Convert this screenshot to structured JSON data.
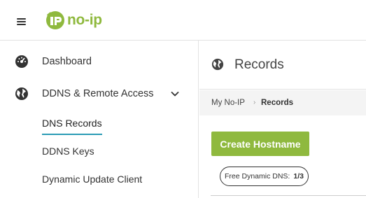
{
  "header": {
    "menu_icon": "hamburger-icon",
    "logo_text": "no-ip",
    "brand_color": "#8fb93e"
  },
  "sidebar": {
    "items": [
      {
        "label": "Dashboard",
        "icon": "dashboard-gauge-icon"
      },
      {
        "label": "DDNS & Remote Access",
        "icon": "globe-icon",
        "expanded": true
      }
    ],
    "subitems": [
      {
        "label": "DNS Records",
        "active": true
      },
      {
        "label": "DDNS Keys"
      },
      {
        "label": "Dynamic Update Client"
      }
    ],
    "active_color": "#2a9bb5"
  },
  "main": {
    "title": "Records",
    "title_icon": "globe-icon",
    "breadcrumb": {
      "home": "My No-IP",
      "current": "Records"
    },
    "create_button": "Create Hostname",
    "quota": {
      "label": "Free Dynamic DNS:",
      "value": "1/3"
    }
  }
}
